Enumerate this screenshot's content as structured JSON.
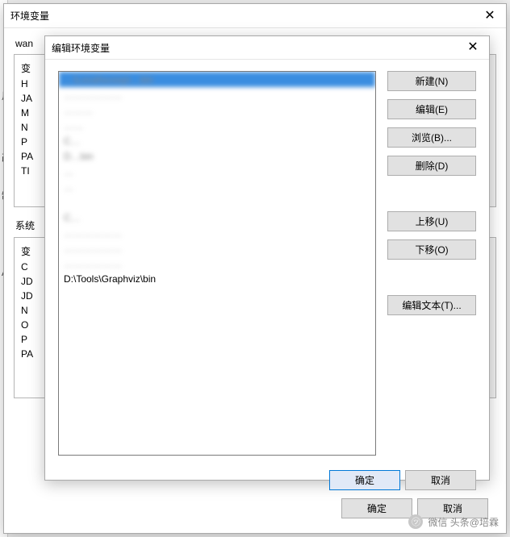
{
  "edge_labels": [
    "用",
    "改",
    "制",
    "Alt"
  ],
  "outer": {
    "title": "环境变量",
    "close_glyph": "✕",
    "user_vars_prefix": "wan",
    "user_rows": [
      "变",
      "H",
      "JA",
      "M",
      "N",
      "P",
      "PA",
      "TI"
    ],
    "sys_label": "系统",
    "sys_rows": [
      "变",
      "C",
      "JD",
      "JD",
      "N",
      "O",
      "P",
      "PA"
    ],
    "ok": "确定",
    "cancel": "取消"
  },
  "inner": {
    "title": "编辑环境变量",
    "close_glyph": "✕",
    "paths": [
      {
        "text": "…\\Local\\scoop\\…bin",
        "selected": true,
        "blur": true
      },
      {
        "text": "………………",
        "blur": true
      },
      {
        "text": "………",
        "blur": true
      },
      {
        "text": "……",
        "blur": true
      },
      {
        "text": "C…",
        "blur": true
      },
      {
        "text": "D…bin",
        "blur": true
      },
      {
        "text": "…",
        "blur": true
      },
      {
        "text": "…",
        "blur": true
      },
      {
        "text": "",
        "blank": true
      },
      {
        "text": "C…",
        "blur": true
      },
      {
        "text": "………………",
        "blur": true
      },
      {
        "text": "………………",
        "blur": true
      },
      {
        "text": "………………",
        "blur": true
      },
      {
        "text": "D:\\Tools\\Graphviz\\bin",
        "blur": false
      }
    ],
    "extra_blank_rows": 11,
    "buttons": {
      "new_": "新建(N)",
      "edit": "编辑(E)",
      "browse": "浏览(B)...",
      "delete_": "删除(D)",
      "move_up": "上移(U)",
      "move_down": "下移(O)",
      "edit_text": "编辑文本(T)..."
    },
    "ok": "确定",
    "cancel": "取消"
  },
  "watermark": "微信 头条@培霖"
}
